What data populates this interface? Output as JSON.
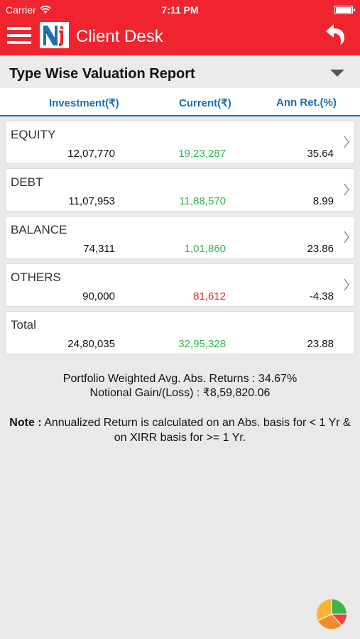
{
  "status_bar": {
    "carrier": "Carrier",
    "time": "7:11 PM",
    "wifi_icon": "wifi-icon",
    "battery_icon": "battery-icon"
  },
  "header": {
    "title": "Client Desk",
    "menu_icon": "hamburger-menu-icon",
    "back_icon": "back-arrow-icon",
    "brand_color": "#f0242f"
  },
  "report": {
    "title": "Type Wise Valuation Report",
    "dropdown_icon": "caret-down-icon"
  },
  "columns": {
    "investment": "Investment(₹)",
    "current": "Current(₹)",
    "ann_ret": "Ann Ret.(%)"
  },
  "rows": [
    {
      "name": "EQUITY",
      "investment": "12,07,770",
      "current": "19,23,287",
      "ann_ret": "35.64",
      "trend": "positive"
    },
    {
      "name": "DEBT",
      "investment": "11,07,953",
      "current": "11,88,570",
      "ann_ret": "8.99",
      "trend": "positive"
    },
    {
      "name": "BALANCE",
      "investment": "74,311",
      "current": "1,01,860",
      "ann_ret": "23.86",
      "trend": "positive"
    },
    {
      "name": "OTHERS",
      "investment": "90,000",
      "current": "81,612",
      "ann_ret": "-4.38",
      "trend": "negative"
    }
  ],
  "total": {
    "name": "Total",
    "investment": "24,80,035",
    "current": "32,95,328",
    "ann_ret": "23.88"
  },
  "summary": {
    "weighted_returns": "Portfolio Weighted Avg. Abs. Returns : 34.67%",
    "notional_gain": "Notional Gain/(Loss) : ₹8,59,820.06"
  },
  "note": {
    "label": "Note :",
    "text": " Annualized Return is calculated on an Abs. basis for < 1 Yr & on XIRR basis for >= 1 Yr."
  },
  "colors": {
    "positive": "#2fb64a",
    "negative": "#e0282e",
    "accent": "#1b6fb3"
  },
  "pie_button_icon": "pie-chart-icon"
}
